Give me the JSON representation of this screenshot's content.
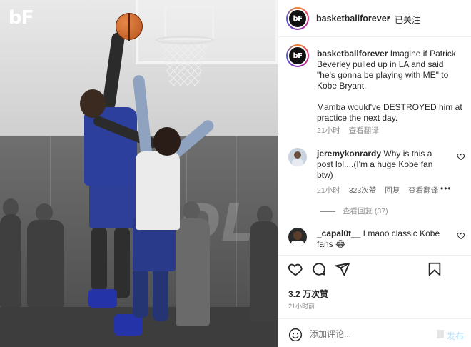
{
  "photo": {
    "logo_text": "bF",
    "court_wordmark": "DL"
  },
  "header": {
    "username": "basketballforever",
    "separator": "•",
    "follow_status": "已关注",
    "avatar_initials": "bF"
  },
  "caption": {
    "username": "basketballforever",
    "paragraph_1": "Imagine if Patrick Beverley pulled up in LA and said \"he's gonna be playing with ME\" to Kobe Bryant.",
    "paragraph_2": "Mamba would've DESTROYED him at practice the next day.",
    "time": "21小时",
    "translate": "查看翻译"
  },
  "comments": [
    {
      "username": "jeremykonrardy",
      "text": "Why is this a post lol....(I'm a huge Kobe fan btw)",
      "time": "21小时",
      "likes": "323次赞",
      "reply": "回复",
      "translate": "查看翻译",
      "more": "•••"
    },
    {
      "username": "_capal0t__",
      "text": "Lmaoo classic Kobe fans 😂"
    }
  ],
  "view_replies": "查看回复 (37)",
  "actions": {
    "like_icon": "heart-icon",
    "comment_icon": "comment-icon",
    "share_icon": "share-icon",
    "save_icon": "bookmark-icon"
  },
  "likes_count": "3.2 万次赞",
  "posted_time": "21小时前",
  "comment_box": {
    "placeholder": "添加评论...",
    "post_label": "发布",
    "emoji_icon": "smiley-icon"
  },
  "colors": {
    "text_primary": "#262626",
    "text_secondary": "#8e8e8e",
    "post_disabled": "#b2dffc",
    "jersey_blue": "#2c3f9c"
  }
}
